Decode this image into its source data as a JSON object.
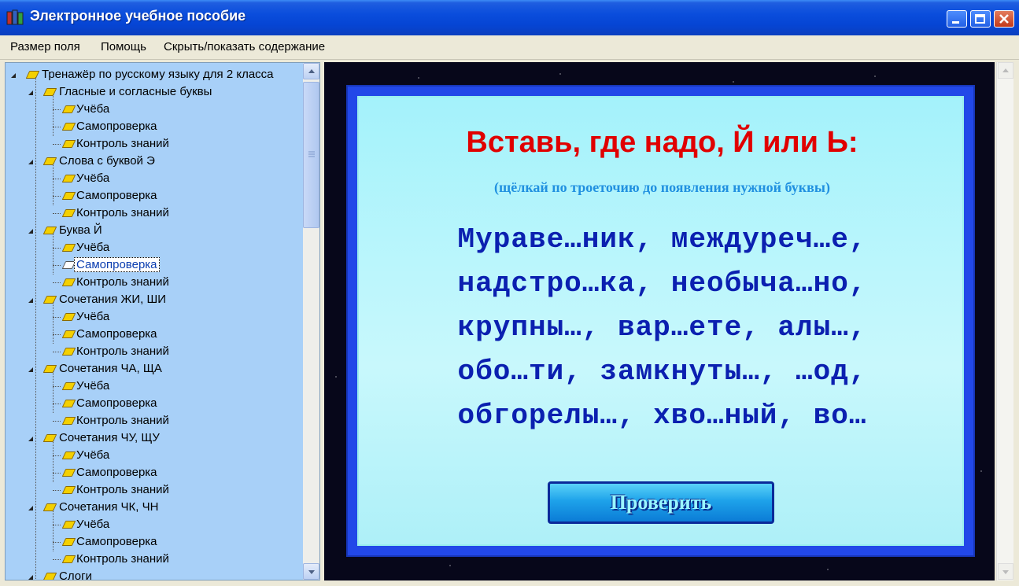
{
  "window": {
    "title": "Электронное учебное пособие",
    "colors": {
      "titlebar": "#0645d4",
      "tree_bg": "#a8d0f8",
      "card_bg": "#b4f4fb",
      "heading": "#e00000",
      "words": "#0b20b0"
    }
  },
  "menu": {
    "items": [
      "Размер поля",
      "Помощь",
      "Скрыть/показать содержание"
    ]
  },
  "tree": {
    "root": "Тренажёр по русскому языку для 2 класса",
    "sections": [
      {
        "label": "Гласные и согласные буквы",
        "children": [
          "Учёба",
          "Самопроверка",
          "Контроль знаний"
        ]
      },
      {
        "label": "Слова с буквой Э",
        "children": [
          "Учёба",
          "Самопроверка",
          "Контроль знаний"
        ]
      },
      {
        "label": "Буква Й",
        "children": [
          "Учёба",
          "Самопроверка",
          "Контроль знаний"
        ]
      },
      {
        "label": "Сочетания ЖИ, ШИ",
        "children": [
          "Учёба",
          "Самопроверка",
          "Контроль знаний"
        ]
      },
      {
        "label": "Сочетания ЧА, ЩА",
        "children": [
          "Учёба",
          "Самопроверка",
          "Контроль знаний"
        ]
      },
      {
        "label": "Сочетания ЧУ, ЩУ",
        "children": [
          "Учёба",
          "Самопроверка",
          "Контроль знаний"
        ]
      },
      {
        "label": "Сочетания ЧК, ЧН",
        "children": [
          "Учёба",
          "Самопроверка",
          "Контроль знаний"
        ]
      },
      {
        "label": "Слоги",
        "children": []
      }
    ],
    "selected": {
      "section": 2,
      "child": 1
    }
  },
  "exercise": {
    "heading": "Вставь, где надо, Й или Ь:",
    "hint": "(щёлкай по троеточию до появления нужной буквы)",
    "lines": [
      "Мураве…ник, междуреч…е,",
      "надстро…ка, необыча…но,",
      "крупны…, вар…ете, алы…,",
      "обо…ти, замкнуты…, …од,",
      "обгорелы…, хво…ный, во…"
    ],
    "check_button": "Проверить"
  }
}
